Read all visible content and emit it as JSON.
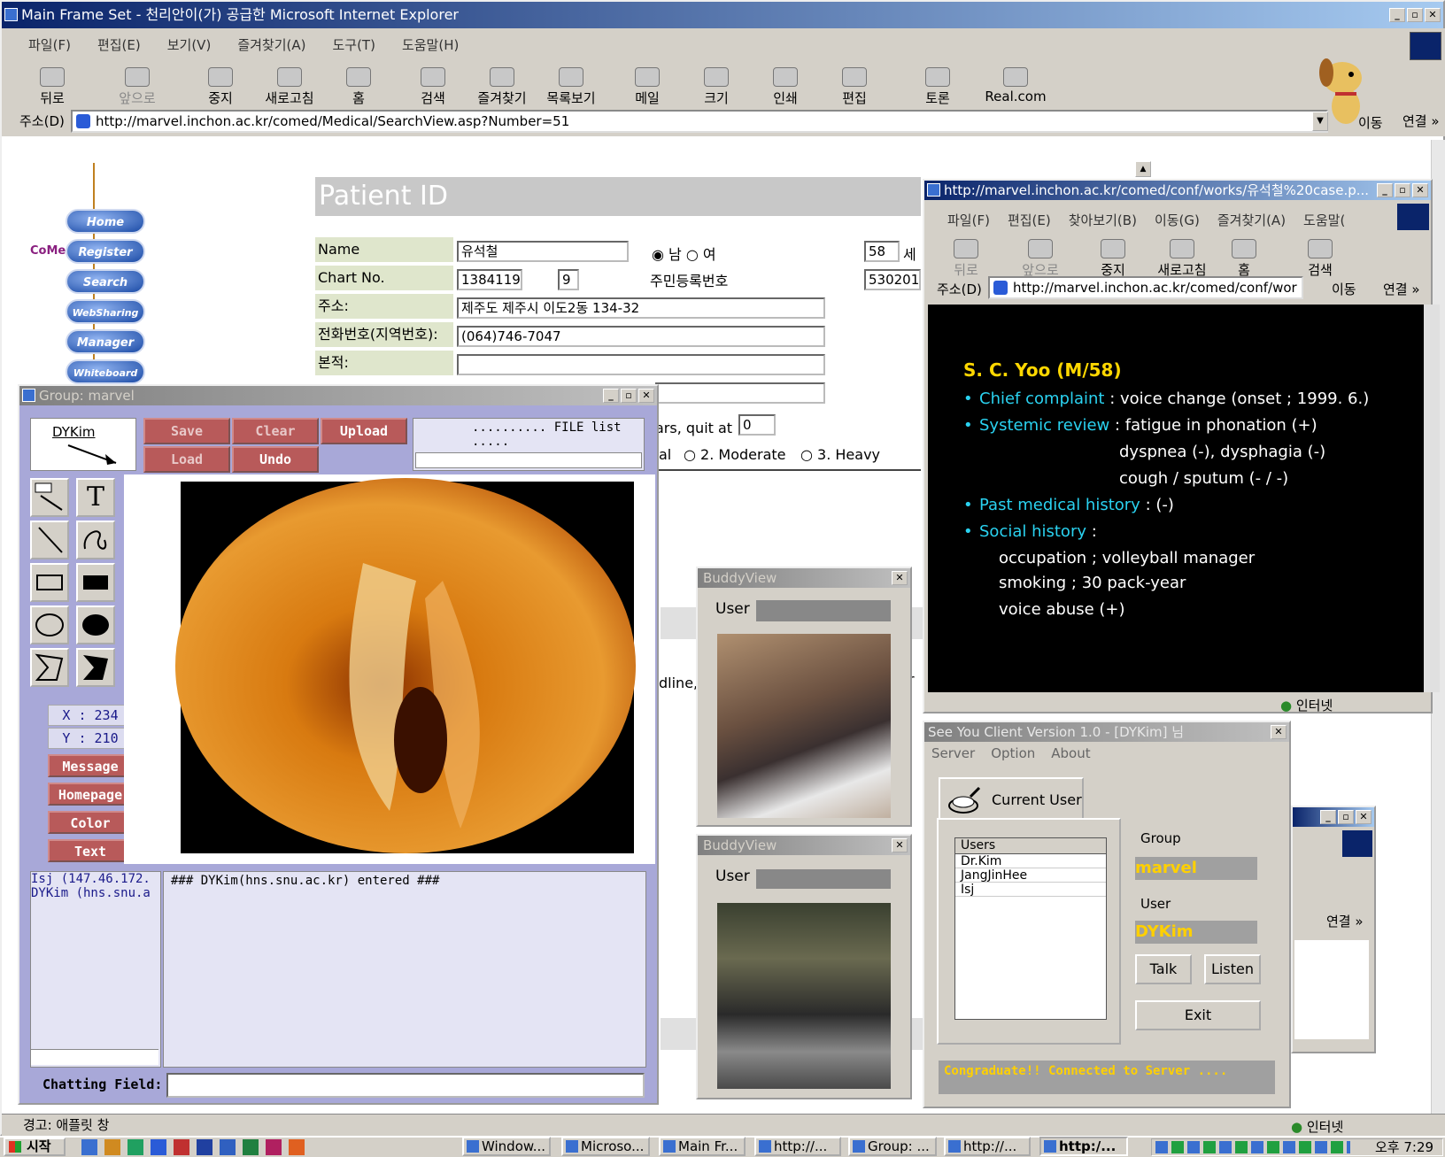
{
  "ie_main": {
    "title": "Main Frame Set - 천리안이(가) 공급한 Microsoft Internet Explorer",
    "menu": [
      "파일(F)",
      "편집(E)",
      "보기(V)",
      "즐겨찾기(A)",
      "도구(T)",
      "도움말(H)"
    ],
    "toolbar": [
      "뒤로",
      "앞으로",
      "중지",
      "새로고침",
      "홈",
      "검색",
      "즐겨찾기",
      "목록보기",
      "메일",
      "크기",
      "인쇄",
      "편집",
      "토론",
      "Real.com"
    ],
    "address_label": "주소(D)",
    "address": "http://marvel.inchon.ac.kr/comed/Medical/SearchView.asp?Number=51",
    "go_label": "이동",
    "links_label": "연결 »",
    "status": "경고: 애플릿 창",
    "status_zone": "인터넷"
  },
  "comed": {
    "logo": "CoMed",
    "nav": [
      "Home",
      "Register",
      "Search",
      "WebSharing",
      "Manager",
      "Whiteboard"
    ]
  },
  "patient": {
    "header": "Patient ID",
    "name_label": "Name",
    "name": "유석철",
    "sex_male": "남",
    "sex_female": "여",
    "age": "58",
    "age_unit": "세",
    "chart_label": "Chart No.",
    "chart": "1384119",
    "chart_suffix": "9",
    "rrn_label": "주민등록번호",
    "rrn": "530201",
    "addr_label": "주소:",
    "addr": "제주도 제주시 이도2동 134-32",
    "phone_label": "전화번호(지역번호):",
    "phone": "(064)746-7047",
    "origin_label": "본적:",
    "origin": "",
    "smoke_text": "ars, quit at",
    "smoke_val": "0",
    "alcohol_partial": "al",
    "moderate": "2. Moderate",
    "heavy": "3. Heavy",
    "frag1": "dline,",
    "frag2": "r"
  },
  "ie_small": {
    "title": "http://marvel.inchon.ac.kr/comed/conf/works/유석철%20case.p...",
    "menu": [
      "파일(F)",
      "편집(E)",
      "찾아보기(B)",
      "이동(G)",
      "즐겨찾기(A)",
      "도움말("
    ],
    "toolbar": [
      "뒤로",
      "앞으로",
      "중지",
      "새로고침",
      "홈",
      "검색"
    ],
    "address_label": "주소(D)",
    "address": "http://marvel.inchon.ac.kr/comed/conf/wor",
    "go_label": "이동",
    "links_label": "연결 »",
    "status_zone": "인터넷"
  },
  "slide": {
    "title": "S. C. Yoo (M/58)",
    "l1a": "Chief complaint",
    "l1b": ": voice change (onset ; 1999. 6.)",
    "l2a": "Systemic review",
    "l2b": ": fatigue in phonation (+)",
    "l3": "dyspnea (-), dysphagia (-)",
    "l4": "cough / sputum (- / -)",
    "l5a": "Past medical history",
    "l5b": ": (-)",
    "l6a": "Social history",
    "l6b": ":",
    "l7": "occupation ; volleyball manager",
    "l8": "smoking ; 30 pack-year",
    "l9": "voice abuse (+)"
  },
  "group": {
    "title": "Group: marvel",
    "user": "DYKim",
    "buttons": {
      "save": "Save",
      "clear": "Clear",
      "upload": "Upload",
      "load": "Load",
      "undo": "Undo"
    },
    "file_list": ".......... FILE list .....",
    "x": "X : 234",
    "y": "Y : 210",
    "side": [
      "Message",
      "Homepage",
      "Color",
      "Text"
    ],
    "users": [
      "Isj (147.46.172.",
      "DYKim (hns.snu.a"
    ],
    "chat": "### DYKim(hns.snu.ac.kr) entered ###",
    "chat_label": "Chatting Field:"
  },
  "buddy1": {
    "title": "BuddyView",
    "user_label": "User"
  },
  "buddy2": {
    "title": "BuddyView",
    "user_label": "User"
  },
  "seeyou": {
    "title": "See You Client Version 1.0 - [DYKim] 님",
    "menu": [
      "Server",
      "Option",
      "About"
    ],
    "tab": "Current User",
    "users_header": "Users",
    "users": [
      "Dr.Kim",
      "JangJinHee",
      "Isj"
    ],
    "group_label": "Group",
    "group": "marvel",
    "user_label": "User",
    "user": "DYKim",
    "talk": "Talk",
    "listen": "Listen",
    "exit": "Exit",
    "status": "Congraduate!! Connected to Server ...."
  },
  "taskbar": {
    "start": "시작",
    "tasks": [
      "Window...",
      "Microso...",
      "Main Fr...",
      "http://...",
      "Group: ...",
      "http://...",
      "http:/..."
    ],
    "clock": "오후 7:29"
  },
  "colors": {
    "title_active": "#0a246a",
    "sidebar_blue": "#a8a8d8",
    "button_red": "#b85a5a",
    "slide_bg": "#000000",
    "slide_accent": "#2ad2f0",
    "slide_title": "#ffd700"
  }
}
